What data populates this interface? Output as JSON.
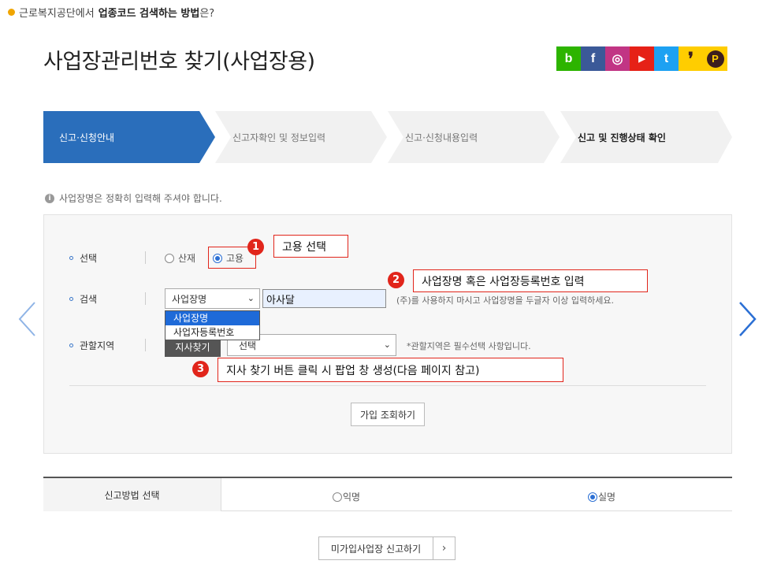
{
  "top_notice": {
    "prefix": "근로복지공단에서 ",
    "bold": "업종코드 검색하는 방법",
    "suffix": "은?"
  },
  "page_title": "사업장관리번호 찾기(사업장용)",
  "social": [
    {
      "icon": "blog-icon",
      "glyph": "b",
      "color": "#2db400"
    },
    {
      "icon": "facebook-icon",
      "glyph": "f",
      "color": "#3b5998"
    },
    {
      "icon": "instagram-icon",
      "glyph": "◎",
      "color": "#c13584"
    },
    {
      "icon": "youtube-icon",
      "glyph": "▶",
      "color": "#e62117"
    },
    {
      "icon": "twitter-icon",
      "glyph": "t",
      "color": "#1da1f2"
    },
    {
      "icon": "kakaostory-icon",
      "glyph": "❜",
      "color": "#ffcd00"
    },
    {
      "icon": "kakao-icon",
      "glyph": "P",
      "color": "#ffcd00"
    }
  ],
  "steps": [
    {
      "label": "신고·신청안내",
      "active": true
    },
    {
      "label": "신고자확인 및 정보입력",
      "active": false
    },
    {
      "label": "신고·신청내용입력",
      "active": false
    },
    {
      "label": "신고 및 진행상태 확인",
      "active": false
    }
  ],
  "notice": "사업장명은 정확히 입력해 주셔야 합니다.",
  "form": {
    "select_label": "선택",
    "option_sanjae": "산재",
    "option_goyong": "고용",
    "selected_option": "고용",
    "search_label": "검색",
    "search_type_value": "사업장명",
    "search_input_value": "아사달",
    "search_hint": "(주)를 사용하지 마시고 사업장명을 두글자 이상 입력하세요.",
    "dropdown_options": [
      "사업장명",
      "사업자등록번호"
    ],
    "dropdown_selected": "사업장명",
    "region_label": "관할지역",
    "branch_button": "지사찾기",
    "region_select_value": "선택",
    "region_hint": "*관할지역은 필수선택 사항입니다.",
    "lookup_button": "가입 조회하기"
  },
  "callouts": [
    {
      "num": "1",
      "text": "고용 선택"
    },
    {
      "num": "2",
      "text": "사업장명 혹은 사업장등록번호 입력"
    },
    {
      "num": "3",
      "text": "지사 찾기 버튼 클릭 시 팝업 창 생성(다음 페이지 참고)"
    }
  ],
  "report_method": {
    "label": "신고방법 선택",
    "option_anonymous": "익명",
    "option_realname": "실명",
    "selected": "실명"
  },
  "unregistered_report_button": "미가입사업장 신고하기",
  "colors": {
    "accent": "#1e6ad8",
    "step_active": "#2a6ebb",
    "callout_red": "#e1251b"
  }
}
